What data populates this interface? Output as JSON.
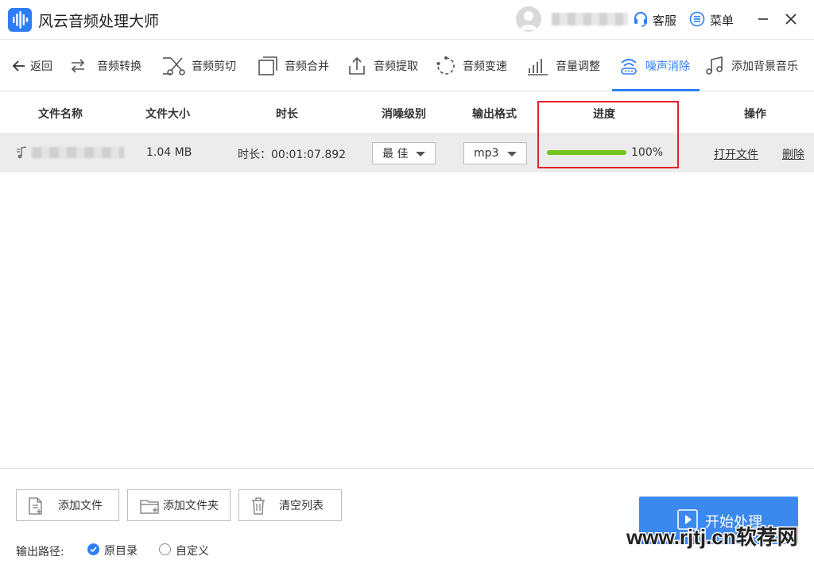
{
  "app": {
    "title": "风云音频处理大师"
  },
  "header": {
    "service_label": "客服",
    "menu_label": "菜单"
  },
  "toolbar": {
    "back": "返回",
    "items": [
      {
        "label": "音频转换",
        "icon": "convert-icon"
      },
      {
        "label": "音频剪切",
        "icon": "scissors-icon"
      },
      {
        "label": "音频合并",
        "icon": "merge-icon"
      },
      {
        "label": "音频提取",
        "icon": "extract-icon"
      },
      {
        "label": "音频变速",
        "icon": "speed-icon"
      },
      {
        "label": "音量调整",
        "icon": "volume-bars-icon"
      },
      {
        "label": "噪声消除",
        "icon": "noise-wave-icon",
        "active": true
      },
      {
        "label": "添加背景音乐",
        "icon": "music-note-icon"
      }
    ]
  },
  "table": {
    "headers": {
      "name": "文件名称",
      "size": "文件大小",
      "duration": "时长",
      "level": "消噪级别",
      "format": "输出格式",
      "progress": "进度",
      "action": "操作"
    },
    "rows": [
      {
        "size": "1.04 MB",
        "duration": "时长：00:01:07.892",
        "level": "最 佳",
        "format": "mp3",
        "progress": 1.0,
        "progress_text": "100%",
        "open": "打开文件",
        "delete": "删除"
      }
    ]
  },
  "bottom": {
    "add_file": "添加文件",
    "add_folder": "添加文件夹",
    "clear_list": "清空列表",
    "output_label": "输出路径:",
    "opt_original": "原目录",
    "opt_custom": "自定义",
    "start": "开始处理"
  },
  "watermark": "www.rjtj.cn软荐网",
  "colors": {
    "accent": "#2f7df6",
    "progress": "#74c41f",
    "highlight": "#e5202a"
  }
}
